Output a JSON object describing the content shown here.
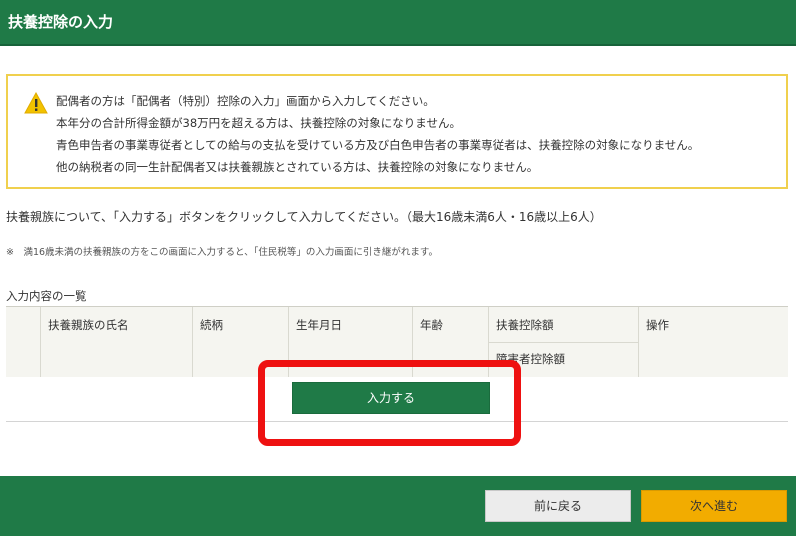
{
  "header": {
    "title": "扶養控除の入力"
  },
  "warning": {
    "lines": [
      "配偶者の方は「配偶者（特別）控除の入力」画面から入力してください。",
      "本年分の合計所得金額が38万円を超える方は、扶養控除の対象になりません。",
      "青色申告者の事業専従者としての給与の支払を受けている方及び白色申告者の事業専従者は、扶養控除の対象になりません。",
      "他の納税者の同一生計配偶者又は扶養親族とされている方は、扶養控除の対象になりません。"
    ],
    "accent_color": "#f0d04e"
  },
  "instruction": "扶養親族について、「入力する」ボタンをクリックして入力してください。（最大16歳未満6人・16歳以上6人）",
  "note": "※　満16歳未満の扶養親族の方をこの画面に入力すると、「住民税等」の入力画面に引き継がれます。",
  "list": {
    "title": "入力内容の一覧",
    "columns": {
      "name": "扶養親族の氏名",
      "relation": "続柄",
      "birthdate": "生年月日",
      "age": "年齢",
      "deduction": "扶養控除額",
      "disability": "障害者控除額",
      "operation": "操作"
    }
  },
  "buttons": {
    "input": "入力する",
    "back": "前に戻る",
    "next": "次へ進む"
  },
  "colors": {
    "brand_green": "#1f7a47",
    "next_button": "#f2ac00",
    "highlight_red": "#ee1111"
  }
}
